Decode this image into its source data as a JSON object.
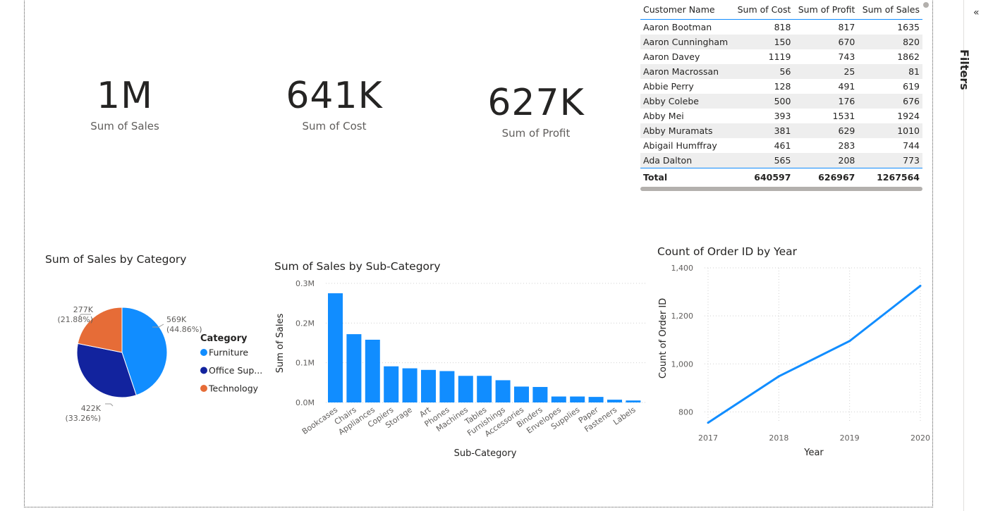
{
  "filters": {
    "label": "Filters",
    "collapse_icon": "«"
  },
  "cards": [
    {
      "value": "1M",
      "label": "Sum of Sales"
    },
    {
      "value": "641K",
      "label": "Sum of Cost"
    },
    {
      "value": "627K",
      "label": "Sum of Profit"
    }
  ],
  "table": {
    "headers": [
      "Customer Name",
      "Sum of Cost",
      "Sum of Profit",
      "Sum of Sales"
    ],
    "rows": [
      [
        "Aaron Bootman",
        "818",
        "817",
        "1635"
      ],
      [
        "Aaron Cunningham",
        "150",
        "670",
        "820"
      ],
      [
        "Aaron Davey",
        "1119",
        "743",
        "1862"
      ],
      [
        "Aaron Macrossan",
        "56",
        "25",
        "81"
      ],
      [
        "Abbie Perry",
        "128",
        "491",
        "619"
      ],
      [
        "Abby Colebe",
        "500",
        "176",
        "676"
      ],
      [
        "Abby Mei",
        "393",
        "1531",
        "1924"
      ],
      [
        "Abby Muramats",
        "381",
        "629",
        "1010"
      ],
      [
        "Abigail Humffray",
        "461",
        "283",
        "744"
      ],
      [
        "Ada Dalton",
        "565",
        "208",
        "773"
      ]
    ],
    "total": [
      "Total",
      "640597",
      "626967",
      "1267564"
    ]
  },
  "chart_data": [
    {
      "type": "pie",
      "title": "Sum of Sales by Category",
      "legend_title": "Category",
      "legend_position": "right",
      "categories": [
        "Furniture",
        "Office Sup...",
        "Technology"
      ],
      "values": [
        569,
        422,
        277
      ],
      "value_labels": [
        "569K",
        "422K",
        "277K"
      ],
      "percent_labels": [
        "(44.86%)",
        "(33.26%)",
        "(21.88%)"
      ],
      "colors": [
        "#118dff",
        "#12239e",
        "#e66c37"
      ]
    },
    {
      "type": "bar",
      "title": "Sum of Sales by Sub-Category",
      "xlabel": "Sub-Category",
      "ylabel": "Sum of Sales",
      "ylim": [
        0,
        0.3
      ],
      "yticks": [
        "0.0M",
        "0.1M",
        "0.2M",
        "0.3M"
      ],
      "categories": [
        "Bookcases",
        "Chairs",
        "Appliances",
        "Copiers",
        "Storage",
        "Art",
        "Phones",
        "Machines",
        "Tables",
        "Furnishings",
        "Accessories",
        "Binders",
        "Envelopes",
        "Supplies",
        "Paper",
        "Fasteners",
        "Labels"
      ],
      "values": [
        0.275,
        0.172,
        0.158,
        0.091,
        0.086,
        0.082,
        0.079,
        0.067,
        0.067,
        0.056,
        0.04,
        0.039,
        0.015,
        0.015,
        0.014,
        0.007,
        0.005
      ],
      "color": "#118dff",
      "grid": true
    },
    {
      "type": "line",
      "title": "Count of Order ID by Year",
      "xlabel": "Year",
      "ylabel": "Count of Order ID",
      "ylim": [
        760,
        1400
      ],
      "yticks": [
        "800",
        "1,000",
        "1,200",
        "1,400"
      ],
      "x": [
        "2017",
        "2018",
        "2019",
        "2020"
      ],
      "values": [
        755,
        948,
        1095,
        1325
      ],
      "color": "#118dff",
      "grid": true
    }
  ]
}
